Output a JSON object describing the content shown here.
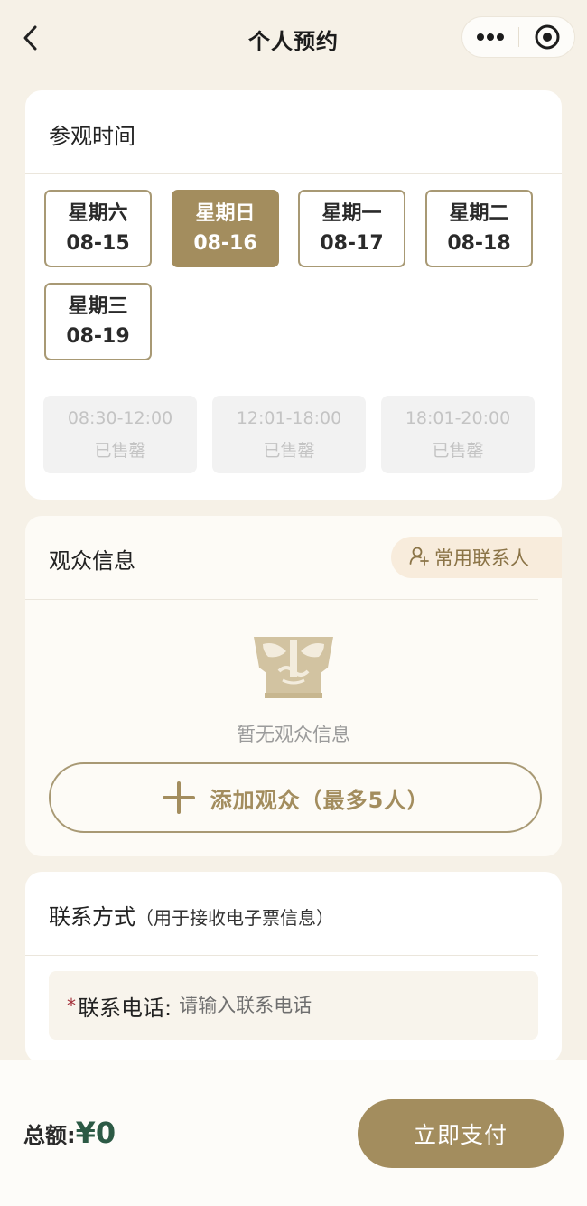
{
  "header": {
    "title": "个人预约",
    "back_icon": "chevron-left-icon",
    "more_icon": "more-dots-icon",
    "target_icon": "target-circle-icon"
  },
  "visit_time": {
    "title": "参观时间",
    "dates": [
      {
        "weekday": "星期六",
        "date": "08-15",
        "selected": false
      },
      {
        "weekday": "星期日",
        "date": "08-16",
        "selected": true
      },
      {
        "weekday": "星期一",
        "date": "08-17",
        "selected": false
      },
      {
        "weekday": "星期二",
        "date": "08-18",
        "selected": false
      },
      {
        "weekday": "星期三",
        "date": "08-19",
        "selected": false
      }
    ],
    "slots": [
      {
        "time": "08:30-12:00",
        "status": "已售罄"
      },
      {
        "time": "12:01-18:00",
        "status": "已售罄"
      },
      {
        "time": "18:01-20:00",
        "status": "已售罄"
      }
    ]
  },
  "audience": {
    "title": "观众信息",
    "contacts_label": "常用联系人",
    "contacts_icon": "add-person-icon",
    "illustration_icon": "bronze-mask-icon",
    "empty_text": "暂无观众信息",
    "add_label": "添加观众（最多5人）",
    "add_icon": "plus-icon"
  },
  "contact": {
    "title": "联系方式",
    "subtitle": "（用于接收电子票信息）",
    "phone_required_mark": "*",
    "phone_label": "联系电话:",
    "phone_placeholder": "请输入联系电话",
    "phone_value": ""
  },
  "footer": {
    "total_label": "总额:",
    "total_amount": "¥0",
    "pay_label": "立即支付"
  },
  "colors": {
    "accent": "#a38d5e",
    "background": "#f6f1e7",
    "price": "#2c5a45",
    "required": "#a3303a"
  }
}
